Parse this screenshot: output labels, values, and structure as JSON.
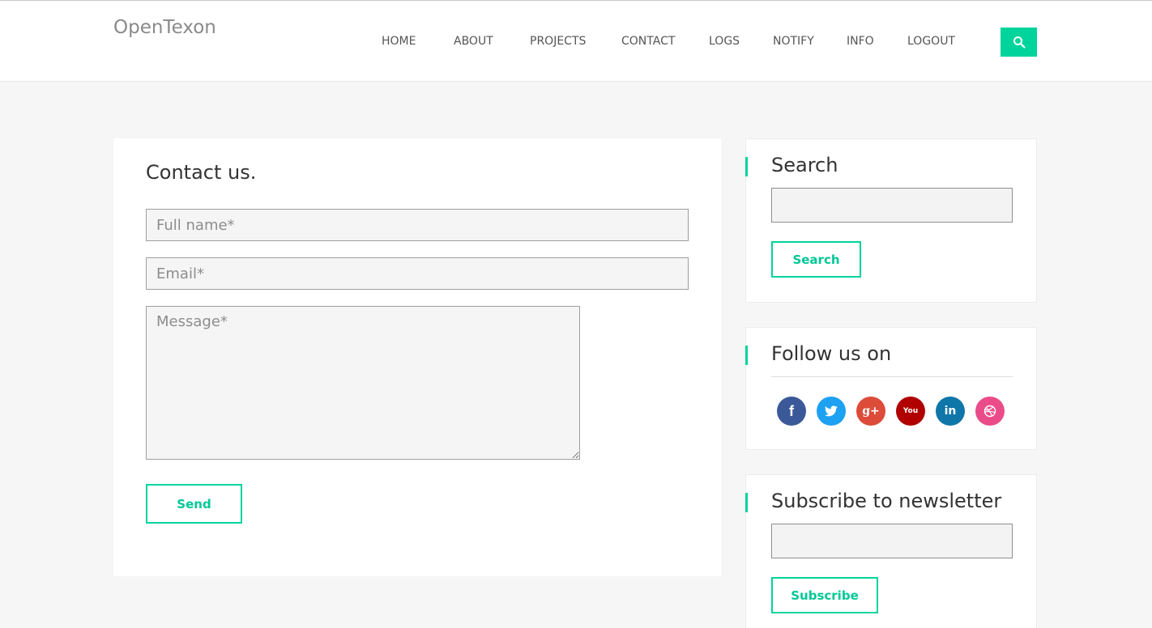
{
  "site": {
    "logo": "OpenTexon"
  },
  "nav": {
    "items": [
      "HOME",
      "ABOUT",
      "PROJECTS",
      "CONTACT",
      "LOGS",
      "NOTIFY",
      "INFO",
      "LOGOUT"
    ]
  },
  "contact": {
    "title": "Contact us.",
    "name_placeholder": "Full name*",
    "email_placeholder": "Email*",
    "message_placeholder": "Message*",
    "send_label": "Send"
  },
  "sidebar": {
    "search": {
      "title": "Search",
      "input_value": "",
      "button_label": "Search"
    },
    "follow": {
      "title": "Follow us on",
      "networks": [
        {
          "name": "facebook",
          "glyph": "f",
          "color": "#3b5998"
        },
        {
          "name": "twitter",
          "glyph": "t",
          "color": "#1da1f2"
        },
        {
          "name": "google-plus",
          "glyph": "g+",
          "color": "#dd4b39"
        },
        {
          "name": "youtube",
          "glyph": "You",
          "color": "#b00000"
        },
        {
          "name": "linkedin",
          "glyph": "in",
          "color": "#0e76a8"
        },
        {
          "name": "dribbble",
          "glyph": "◎",
          "color": "#ea4c89"
        }
      ]
    },
    "subscribe": {
      "title": "Subscribe to newsletter",
      "input_value": "",
      "button_label": "Subscribe"
    }
  },
  "colors": {
    "accent": "#00d49d",
    "page_background": "#f6f6f6"
  }
}
